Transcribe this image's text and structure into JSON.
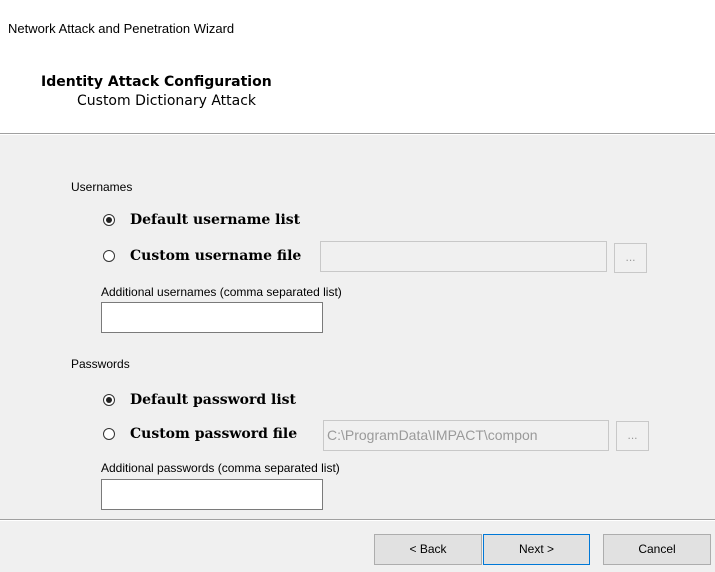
{
  "window": {
    "title": "Network Attack and Penetration Wizard"
  },
  "header": {
    "title": "Identity Attack Configuration",
    "subtitle": "Custom Dictionary Attack"
  },
  "usernames": {
    "group_label": "Usernames",
    "options": [
      {
        "label": "Default username list",
        "checked": true
      },
      {
        "label": "Custom username file",
        "checked": false
      }
    ],
    "file_value": "",
    "browse_label": "...",
    "additional_label": "Additional usernames (comma separated list)",
    "additional_value": ""
  },
  "passwords": {
    "group_label": "Passwords",
    "options": [
      {
        "label": "Default password list",
        "checked": true
      },
      {
        "label": "Custom password file",
        "checked": false
      }
    ],
    "file_value": "C:\\ProgramData\\IMPACT\\compon",
    "browse_label": "...",
    "additional_label": "Additional passwords (comma separated list)",
    "additional_value": ""
  },
  "buttons": {
    "back": "< Back",
    "next": "Next >",
    "cancel": "Cancel"
  }
}
